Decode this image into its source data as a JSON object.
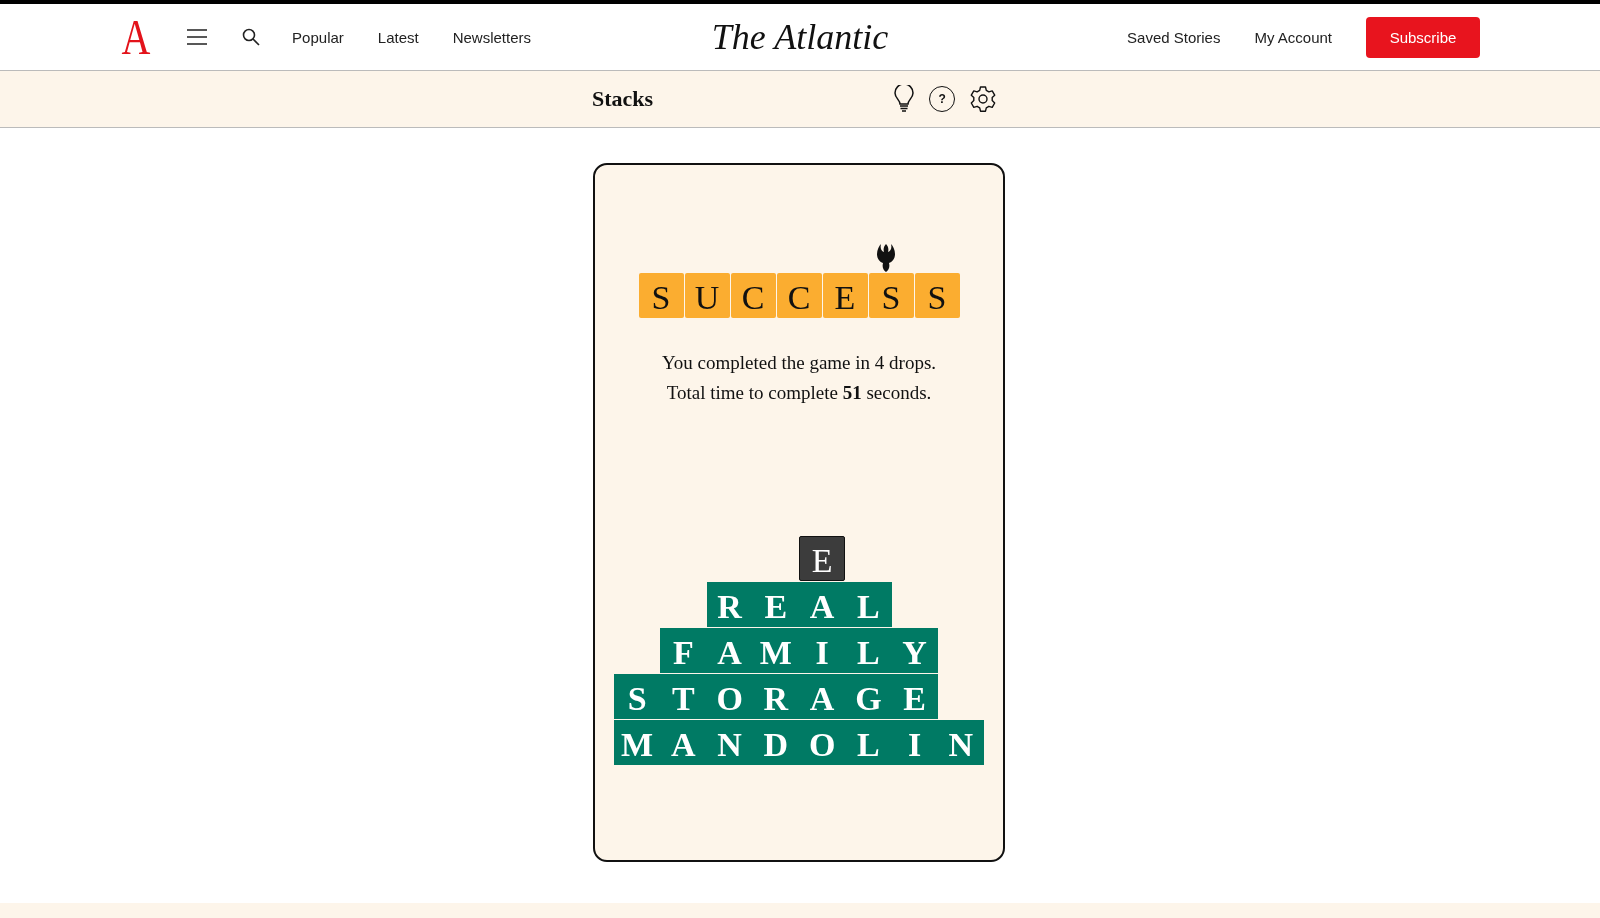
{
  "header": {
    "logo_mark": "A",
    "nav": [
      "Popular",
      "Latest",
      "Newsletters"
    ],
    "logo": "The Atlantic",
    "account_links": [
      "Saved Stories",
      "My Account"
    ],
    "subscribe": "Subscribe"
  },
  "game_bar": {
    "title": "Stacks",
    "help": "?"
  },
  "result": {
    "tiles": [
      "S",
      "U",
      "C",
      "C",
      "E",
      "S",
      "S"
    ],
    "message": [
      "You completed the game in 4 drops.",
      "Total time to complete **51** seconds."
    ]
  },
  "stack": [
    {
      "kind": "falling",
      "cells": [
        {
          "kind": "empty"
        },
        {
          "kind": "empty"
        },
        {
          "kind": "empty"
        },
        {
          "kind": "empty"
        },
        {
          "kind": "letter",
          "text": "E"
        }
      ]
    },
    {
      "kind": "placed",
      "cells": [
        {
          "kind": "empty"
        },
        {
          "kind": "empty"
        },
        {
          "kind": "letter",
          "text": "R"
        },
        {
          "kind": "letter",
          "text": "E"
        },
        {
          "kind": "letter",
          "text": "A"
        },
        {
          "kind": "letter",
          "text": "L"
        }
      ]
    },
    {
      "kind": "placed",
      "cells": [
        {
          "kind": "empty"
        },
        {
          "kind": "letter",
          "text": "F"
        },
        {
          "kind": "letter",
          "text": "A"
        },
        {
          "kind": "letter",
          "text": "M"
        },
        {
          "kind": "letter",
          "text": "I"
        },
        {
          "kind": "letter",
          "text": "L"
        },
        {
          "kind": "letter",
          "text": "Y"
        }
      ]
    },
    {
      "kind": "placed",
      "cells": [
        {
          "kind": "letter",
          "text": "S"
        },
        {
          "kind": "letter",
          "text": "T"
        },
        {
          "kind": "letter",
          "text": "O"
        },
        {
          "kind": "letter",
          "text": "R"
        },
        {
          "kind": "letter",
          "text": "A"
        },
        {
          "kind": "letter",
          "text": "G"
        },
        {
          "kind": "letter",
          "text": "E"
        }
      ]
    },
    {
      "kind": "placed",
      "cells": [
        {
          "kind": "letter",
          "text": "M"
        },
        {
          "kind": "letter",
          "text": "A"
        },
        {
          "kind": "letter",
          "text": "N"
        },
        {
          "kind": "letter",
          "text": "D"
        },
        {
          "kind": "letter",
          "text": "O"
        },
        {
          "kind": "letter",
          "text": "L"
        },
        {
          "kind": "letter",
          "text": "I"
        },
        {
          "kind": "letter",
          "text": "N"
        }
      ]
    }
  ]
}
